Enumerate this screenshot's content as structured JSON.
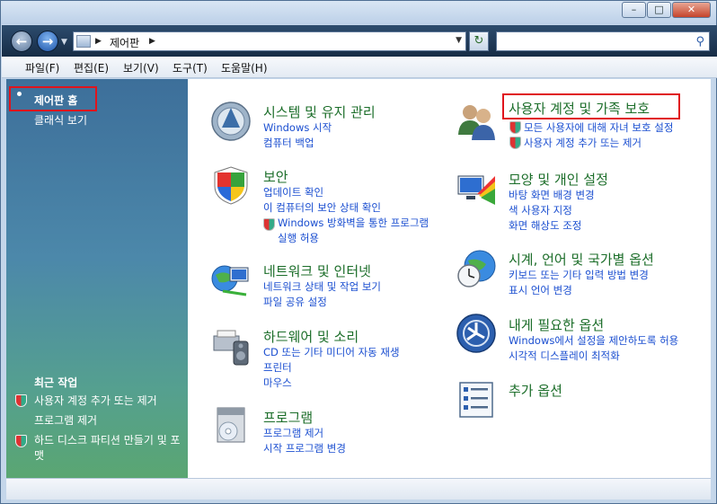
{
  "window": {
    "minimize_glyph": "–",
    "maximize_glyph": "□",
    "close_glyph": "✕"
  },
  "address": {
    "path": "제어판",
    "search_placeholder": ""
  },
  "menu": [
    "파일(F)",
    "편집(E)",
    "보기(V)",
    "도구(T)",
    "도움말(H)"
  ],
  "sidebar": {
    "home_label": "제어판 홈",
    "classic_label": "클래식 보기",
    "recent_title": "최근 작업",
    "recent_items": [
      "사용자 계정 추가 또는 제거",
      "프로그램 제거",
      "하드 디스크 파티션 만들기 및 포맷"
    ]
  },
  "categories": {
    "system": {
      "title": "시스템 및 유지 관리",
      "links": [
        "Windows 시작",
        "컴퓨터 백업"
      ]
    },
    "security": {
      "title": "보안",
      "links": [
        "업데이트 확인",
        "이 컴퓨터의 보안 상태 확인",
        "Windows 방화벽을 통한 프로그램",
        "실행 허용"
      ]
    },
    "network": {
      "title": "네트워크 및 인터넷",
      "links": [
        "네트워크 상태 및 작업 보기",
        "파일 공유 설정"
      ]
    },
    "hardware": {
      "title": "하드웨어 및 소리",
      "links": [
        "CD 또는 기타 미디어 자동 재생",
        "프린터",
        "마우스"
      ]
    },
    "programs": {
      "title": "프로그램",
      "links": [
        "프로그램 제거",
        "시작 프로그램 변경"
      ]
    },
    "users": {
      "title": "사용자 계정 및 가족 보호",
      "links": [
        "모든 사용자에 대해 자녀 보호 설정",
        "사용자 계정 추가 또는 제거"
      ]
    },
    "appearance": {
      "title": "모양 및 개인 설정",
      "links": [
        "바탕 화면 배경 변경",
        "색 사용자 지정",
        "화면 해상도 조정"
      ]
    },
    "clock": {
      "title": "시계, 언어 및 국가별 옵션",
      "links": [
        "키보드 또는 기타 입력 방법 변경",
        "표시 언어 변경"
      ]
    },
    "ease": {
      "title": "내게 필요한 옵션",
      "links": [
        "Windows에서 설정을 제안하도록 허용",
        "시각적 디스플레이 최적화"
      ]
    },
    "additional": {
      "title": "추가 옵션"
    }
  }
}
